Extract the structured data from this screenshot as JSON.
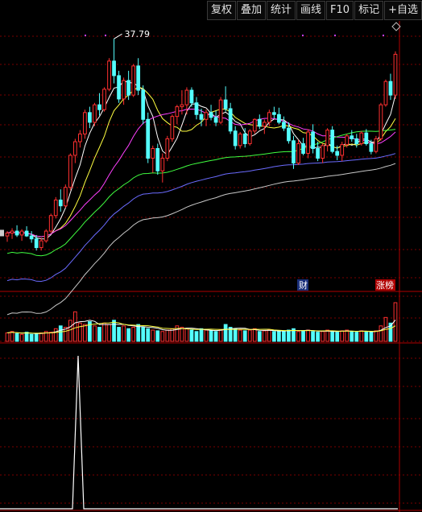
{
  "toolbar": {
    "buttons": [
      "复权",
      "叠加",
      "统计",
      "画线",
      "F10",
      "标记",
      "+自选"
    ]
  },
  "price_panel": {
    "high_label": "37.79",
    "markers": {
      "finance": "财",
      "limit_up": "涨榜"
    },
    "candle_up_color": "#ff3030",
    "candle_down_color": "#54ffff",
    "ma_colors": [
      "#ffffff",
      "#ffff40",
      "#ff40ff",
      "#40ff40",
      "#6b6bff",
      "#c8c8c8"
    ]
  },
  "chart_data": {
    "type": "candlestick",
    "candles": [
      [
        17.5,
        18.0,
        16.9,
        17.8
      ],
      [
        17.8,
        18.3,
        17.2,
        18.0
      ],
      [
        18.0,
        18.6,
        17.4,
        17.6
      ],
      [
        17.6,
        18.2,
        17.0,
        18.0
      ],
      [
        18.0,
        18.5,
        17.4,
        17.5
      ],
      [
        17.5,
        18.0,
        16.8,
        17.2
      ],
      [
        17.2,
        17.6,
        16.0,
        16.3
      ],
      [
        16.3,
        17.3,
        16.0,
        17.0
      ],
      [
        17.0,
        18.2,
        16.8,
        18.0
      ],
      [
        18.0,
        19.8,
        17.8,
        19.6
      ],
      [
        19.6,
        21.5,
        19.3,
        21.2
      ],
      [
        21.2,
        22.3,
        20.0,
        20.6
      ],
      [
        20.6,
        22.8,
        20.4,
        22.5
      ],
      [
        22.5,
        26.0,
        22.2,
        25.8
      ],
      [
        25.8,
        27.5,
        25.0,
        27.2
      ],
      [
        27.2,
        28.4,
        26.6,
        28.0
      ],
      [
        28.0,
        30.5,
        27.5,
        30.2
      ],
      [
        30.2,
        30.8,
        28.6,
        29.2
      ],
      [
        29.2,
        31.2,
        28.8,
        31.0
      ],
      [
        31.0,
        32.2,
        29.9,
        30.5
      ],
      [
        30.5,
        32.8,
        30.3,
        32.6
      ],
      [
        32.6,
        35.8,
        32.4,
        35.5
      ],
      [
        35.5,
        37.79,
        33.2,
        34.0
      ],
      [
        34.0,
        34.5,
        31.2,
        31.6
      ],
      [
        31.6,
        33.8,
        31.0,
        33.5
      ],
      [
        33.5,
        34.5,
        31.5,
        32.0
      ],
      [
        32.0,
        35.2,
        31.8,
        35.0
      ],
      [
        35.0,
        35.8,
        32.0,
        32.5
      ],
      [
        32.5,
        33.0,
        29.0,
        29.5
      ],
      [
        29.5,
        30.2,
        25.0,
        25.5
      ],
      [
        25.5,
        26.8,
        24.0,
        26.5
      ],
      [
        26.5,
        27.0,
        23.8,
        24.2
      ],
      [
        24.2,
        26.0,
        23.0,
        25.5
      ],
      [
        25.5,
        27.8,
        25.2,
        27.5
      ],
      [
        27.5,
        30.0,
        27.2,
        29.8
      ],
      [
        29.8,
        31.0,
        29.0,
        30.8
      ],
      [
        30.8,
        32.5,
        30.0,
        31.0
      ],
      [
        31.0,
        32.8,
        30.0,
        32.5
      ],
      [
        32.5,
        32.8,
        30.8,
        31.2
      ],
      [
        31.2,
        31.8,
        29.5,
        30.0
      ],
      [
        30.0,
        30.6,
        28.8,
        29.5
      ],
      [
        29.5,
        30.5,
        28.8,
        30.2
      ],
      [
        30.2,
        31.0,
        29.4,
        29.7
      ],
      [
        29.7,
        30.4,
        28.8,
        29.2
      ],
      [
        29.2,
        31.8,
        29.0,
        31.5
      ],
      [
        31.5,
        32.9,
        30.3,
        30.6
      ],
      [
        30.6,
        31.2,
        28.0,
        28.3
      ],
      [
        28.3,
        28.8,
        26.4,
        26.8
      ],
      [
        26.8,
        28.2,
        26.5,
        28.0
      ],
      [
        28.0,
        28.6,
        26.6,
        27.0
      ],
      [
        27.0,
        28.5,
        26.8,
        28.3
      ],
      [
        28.3,
        29.6,
        28.0,
        29.5
      ],
      [
        29.5,
        30.0,
        28.5,
        28.8
      ],
      [
        28.8,
        29.5,
        28.0,
        29.2
      ],
      [
        29.2,
        30.5,
        28.8,
        30.2
      ],
      [
        30.2,
        30.8,
        29.6,
        30.0
      ],
      [
        30.0,
        30.7,
        29.0,
        29.2
      ],
      [
        29.2,
        29.8,
        28.3,
        28.6
      ],
      [
        28.6,
        29.2,
        27.0,
        27.3
      ],
      [
        27.3,
        27.8,
        24.4,
        25.0
      ],
      [
        25.0,
        27.4,
        24.8,
        27.0
      ],
      [
        27.0,
        27.6,
        25.8,
        26.0
      ],
      [
        26.0,
        28.5,
        25.5,
        28.2
      ],
      [
        28.2,
        29.0,
        26.0,
        26.5
      ],
      [
        26.5,
        27.2,
        25.2,
        25.5
      ],
      [
        25.5,
        27.0,
        25.0,
        26.8
      ],
      [
        26.8,
        28.6,
        26.2,
        28.4
      ],
      [
        28.4,
        28.8,
        26.0,
        26.2
      ],
      [
        26.2,
        26.8,
        25.3,
        25.8
      ],
      [
        25.8,
        27.2,
        25.2,
        26.9
      ],
      [
        26.9,
        28.0,
        26.6,
        27.8
      ],
      [
        27.8,
        28.4,
        27.2,
        27.5
      ],
      [
        27.5,
        28.0,
        26.6,
        27.0
      ],
      [
        27.0,
        28.3,
        26.8,
        28.1
      ],
      [
        28.1,
        28.5,
        26.8,
        27.0
      ],
      [
        27.0,
        27.4,
        25.9,
        26.2
      ],
      [
        26.2,
        27.8,
        26.0,
        27.5
      ],
      [
        27.5,
        31.2,
        27.3,
        31.0
      ],
      [
        31.0,
        33.6,
        30.8,
        33.4
      ],
      [
        33.4,
        34.2,
        31.5,
        32.0
      ],
      [
        32.0,
        36.5,
        31.6,
        36.2
      ]
    ],
    "volume": [
      12,
      14,
      11,
      10,
      13,
      10,
      11,
      12,
      14,
      13,
      18,
      22,
      20,
      30,
      42,
      26,
      24,
      28,
      22,
      20,
      26,
      24,
      30,
      20,
      22,
      18,
      20,
      24,
      20,
      18,
      16,
      15,
      14,
      16,
      18,
      22,
      20,
      18,
      16,
      14,
      18,
      16,
      15,
      14,
      16,
      24,
      20,
      18,
      16,
      15,
      16,
      18,
      14,
      15,
      16,
      14,
      15,
      14,
      16,
      18,
      14,
      15,
      16,
      14,
      13,
      14,
      16,
      14,
      13,
      15,
      16,
      14,
      13,
      15,
      14,
      13,
      15,
      22,
      34,
      26,
      55
    ]
  }
}
